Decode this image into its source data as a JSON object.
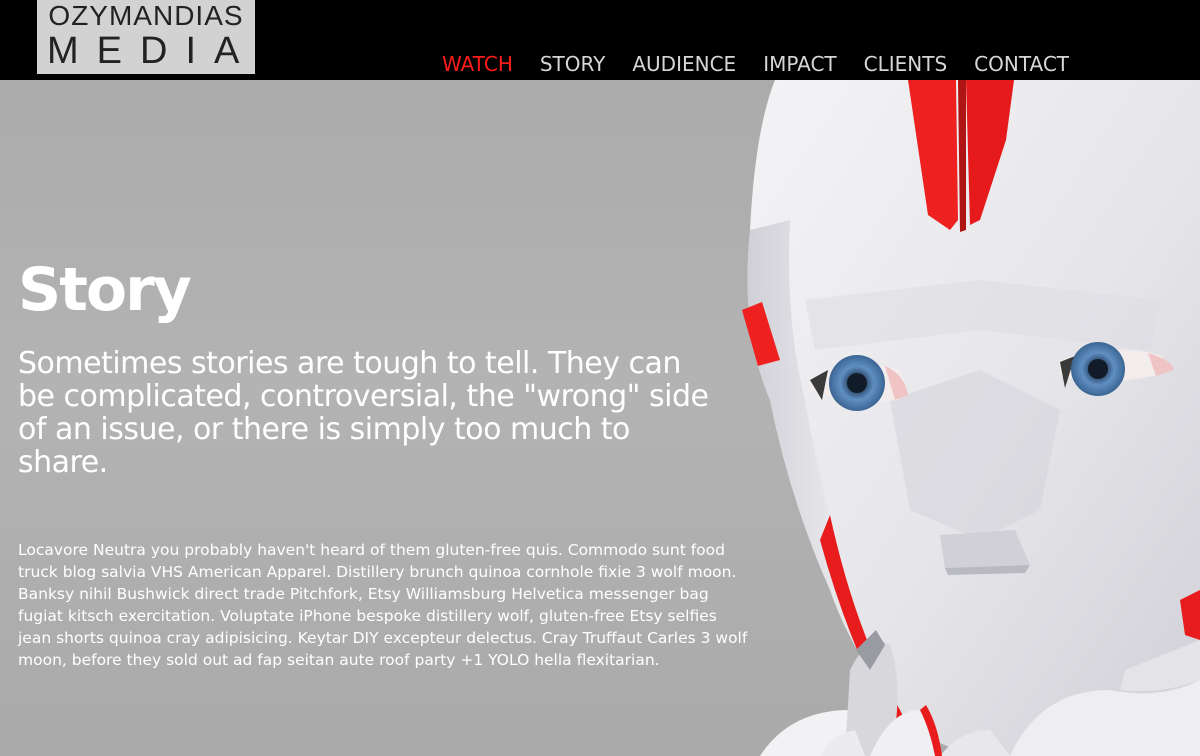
{
  "logo": {
    "line1": "OZYMANDIAS",
    "line2": "MEDIA"
  },
  "nav": {
    "items": [
      {
        "label": "WATCH",
        "active": true
      },
      {
        "label": "STORY",
        "active": false
      },
      {
        "label": "AUDIENCE",
        "active": false
      },
      {
        "label": "IMPACT",
        "active": false
      },
      {
        "label": "CLIENTS",
        "active": false
      },
      {
        "label": "CONTACT",
        "active": false
      }
    ]
  },
  "story": {
    "title": "Story",
    "lead": "Sometimes stories are tough to tell. They can be complicated, controversial, the \"wrong\" side of an issue, or there is simply too much to share.",
    "body": "Locavore Neutra you probably haven't heard of them gluten-free quis. Commodo sunt food truck blog salvia VHS American Apparel. Distillery brunch quinoa cornhole fixie 3 wolf moon. Banksy nihil Bushwick direct trade Pitchfork, Etsy Williamsburg Helvetica messenger bag fugiat kitsch exercitation. Voluptate iPhone bespoke distillery wolf, gluten-free Etsy selfies jean shorts quinoa cray adipisicing. Keytar DIY excepteur delectus. Cray Truffaut Carles 3 wolf moon, before they sold out ad fap seitan aute roof party +1 YOLO hella flexitarian."
  },
  "colors": {
    "header_bg": "#000000",
    "nav_active": "#ff1a1a",
    "nav_text": "#d6d6d6",
    "background": "#b0b0b0",
    "robot_accent": "#ee2020"
  },
  "icons": {
    "hero_image": "robot-figure-image"
  }
}
